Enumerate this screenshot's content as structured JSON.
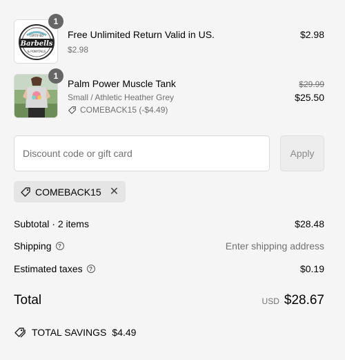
{
  "items": [
    {
      "name": "Free Unlimited Return Valid in US.",
      "variant": "$2.98",
      "price": "$2.98",
      "quantity": "1",
      "thumb_text": [
        "CERTIFIED",
        "Barbells",
        "& PONYTAILS"
      ]
    },
    {
      "name": "Palm Power Muscle Tank",
      "variant": "Small / Athletic Heather Grey",
      "discount": "COMEBACK15 (-$4.49)",
      "original_price": "$29.99",
      "price": "$25.50",
      "quantity": "1"
    }
  ],
  "discount": {
    "placeholder": "Discount code or gift card",
    "apply_label": "Apply",
    "applied_code": "COMEBACK15"
  },
  "summary": {
    "subtotal_label": "Subtotal · 2 items",
    "subtotal_value": "$28.48",
    "shipping_label": "Shipping",
    "shipping_value": "Enter shipping address",
    "taxes_label": "Estimated taxes",
    "taxes_value": "$0.19"
  },
  "total": {
    "label": "Total",
    "currency": "USD",
    "amount": "$28.67"
  },
  "savings": {
    "label": "TOTAL SAVINGS",
    "amount": "$4.49"
  },
  "icons": {
    "tag": "tag-icon",
    "remove": "close-icon",
    "help": "question-circle-icon",
    "savings": "price-tags-icon"
  },
  "colors": {
    "background": "#f5f5f5",
    "muted_text": "#707070",
    "badge": "#666666",
    "tag_chip": "#e5e5e5"
  }
}
